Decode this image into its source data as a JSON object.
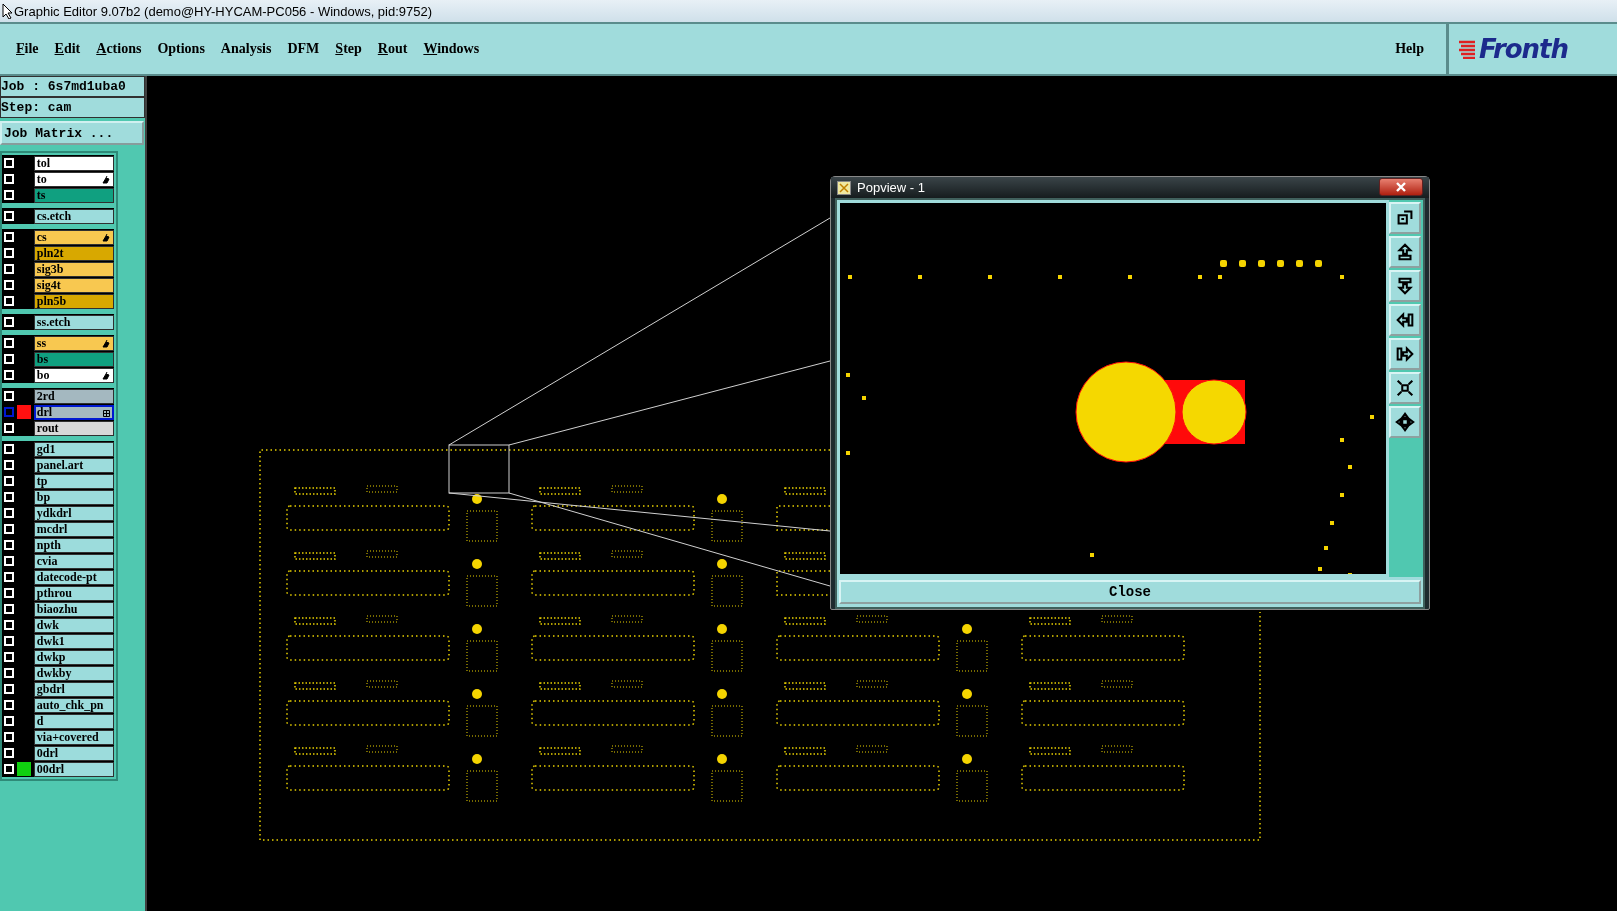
{
  "window": {
    "title": "Graphic Editor 9.07b2 (demo@HY-HYCAM-PC056 - Windows, pid:9752)"
  },
  "menu": [
    {
      "label": "File",
      "mnemonic": true
    },
    {
      "label": "Edit",
      "mnemonic": true
    },
    {
      "label": "Actions",
      "mnemonic": true
    },
    {
      "label": "Options",
      "mnemonic": false
    },
    {
      "label": "Analysis",
      "mnemonic": false
    },
    {
      "label": "DFM",
      "mnemonic": false
    },
    {
      "label": "Step",
      "mnemonic": true
    },
    {
      "label": "Rout",
      "mnemonic": true
    },
    {
      "label": "Windows",
      "mnemonic": true
    }
  ],
  "help": "Help",
  "logo": "Fronth",
  "job": "Job : 6s7md1uba0",
  "step": "Step: cam",
  "job_matrix_button": "Job Matrix ...",
  "layer_groups": [
    {
      "layers": [
        {
          "name": "tol",
          "color": "#ffffff",
          "flagged": false,
          "checked": false,
          "selected": false
        },
        {
          "name": "to",
          "color": "#ffffff",
          "flagged": true,
          "checked": false,
          "selected": false
        },
        {
          "name": "ts",
          "color": "#10a080",
          "flagged": false,
          "checked": false,
          "selected": false
        }
      ]
    },
    {
      "layers": [
        {
          "name": "cs.etch",
          "color": "#9cdcdc",
          "flagged": false,
          "checked": false,
          "selected": false
        }
      ]
    },
    {
      "layers": [
        {
          "name": "cs",
          "color": "#f8c850",
          "flagged": true,
          "checked": false,
          "selected": false
        },
        {
          "name": "pln2t",
          "color": "#d8a800",
          "flagged": false,
          "checked": false,
          "selected": false
        },
        {
          "name": "sig3b",
          "color": "#f8c850",
          "flagged": false,
          "checked": false,
          "selected": false
        },
        {
          "name": "sig4t",
          "color": "#f8c850",
          "flagged": false,
          "checked": false,
          "selected": false
        },
        {
          "name": "pln5b",
          "color": "#d8a800",
          "flagged": false,
          "checked": false,
          "selected": false
        }
      ]
    },
    {
      "layers": [
        {
          "name": "ss.etch",
          "color": "#9cdcdc",
          "flagged": false,
          "checked": false,
          "selected": false
        }
      ]
    },
    {
      "layers": [
        {
          "name": "ss",
          "color": "#f8c850",
          "flagged": true,
          "checked": false,
          "selected": false
        },
        {
          "name": "bs",
          "color": "#10a080",
          "flagged": false,
          "checked": false,
          "selected": false
        },
        {
          "name": "bo",
          "color": "#ffffff",
          "flagged": true,
          "checked": false,
          "selected": false
        }
      ]
    },
    {
      "layers": [
        {
          "name": "2rd",
          "color": "#a4b8c0",
          "flagged": false,
          "checked": false,
          "selected": false
        },
        {
          "name": "drl",
          "color": "#a4b8c0",
          "flagged": false,
          "checked": false,
          "selected": true,
          "swatch": {
            "color": "#ff1010"
          },
          "expandable": true
        },
        {
          "name": "rout",
          "color": "#d8d8d8",
          "flagged": false,
          "checked": false,
          "selected": false
        }
      ]
    },
    {
      "layers": [
        {
          "name": "gd1",
          "color": "#9cdcdc",
          "flagged": false,
          "checked": false,
          "selected": false
        },
        {
          "name": "panel.art",
          "color": "#9cdcdc",
          "flagged": false,
          "checked": false,
          "selected": false
        },
        {
          "name": "tp",
          "color": "#9cdcdc",
          "flagged": false,
          "checked": false,
          "selected": false
        },
        {
          "name": "bp",
          "color": "#9cdcdc",
          "flagged": false,
          "checked": false,
          "selected": false
        },
        {
          "name": "ydkdrl",
          "color": "#9cdcdc",
          "flagged": false,
          "checked": false,
          "selected": false
        },
        {
          "name": "mcdrl",
          "color": "#9cdcdc",
          "flagged": false,
          "checked": false,
          "selected": false
        },
        {
          "name": "npth",
          "color": "#9cdcdc",
          "flagged": false,
          "checked": false,
          "selected": false
        },
        {
          "name": "cvia",
          "color": "#9cdcdc",
          "flagged": false,
          "checked": false,
          "selected": false
        },
        {
          "name": "datecode-pt",
          "color": "#9cdcdc",
          "flagged": false,
          "checked": false,
          "selected": false
        },
        {
          "name": "pthrou",
          "color": "#9cdcdc",
          "flagged": false,
          "checked": false,
          "selected": false
        },
        {
          "name": "biaozhu",
          "color": "#9cdcdc",
          "flagged": false,
          "checked": false,
          "selected": false
        },
        {
          "name": "dwk",
          "color": "#9cdcdc",
          "flagged": false,
          "checked": false,
          "selected": false
        },
        {
          "name": "dwk1",
          "color": "#9cdcdc",
          "flagged": false,
          "checked": false,
          "selected": false
        },
        {
          "name": "dwkp",
          "color": "#9cdcdc",
          "flagged": false,
          "checked": false,
          "selected": false
        },
        {
          "name": "dwkby",
          "color": "#9cdcdc",
          "flagged": false,
          "checked": false,
          "selected": false
        },
        {
          "name": "gbdrl",
          "color": "#9cdcdc",
          "flagged": false,
          "checked": false,
          "selected": false
        },
        {
          "name": "auto_chk_pn",
          "color": "#9cdcdc",
          "flagged": false,
          "checked": false,
          "selected": false
        },
        {
          "name": "d",
          "color": "#9cdcdc",
          "flagged": false,
          "checked": false,
          "selected": false
        },
        {
          "name": "via+covered",
          "color": "#9cdcdc",
          "flagged": false,
          "checked": false,
          "selected": false
        },
        {
          "name": "0drl",
          "color": "#9cdcdc",
          "flagged": false,
          "checked": false,
          "selected": false
        },
        {
          "name": "00drl",
          "color": "#9cdcdc",
          "flagged": false,
          "checked": false,
          "selected": false,
          "swatch": {
            "color": "#10d010"
          }
        }
      ]
    }
  ],
  "popview": {
    "title": "Popview - 1",
    "close_button": "Close"
  }
}
